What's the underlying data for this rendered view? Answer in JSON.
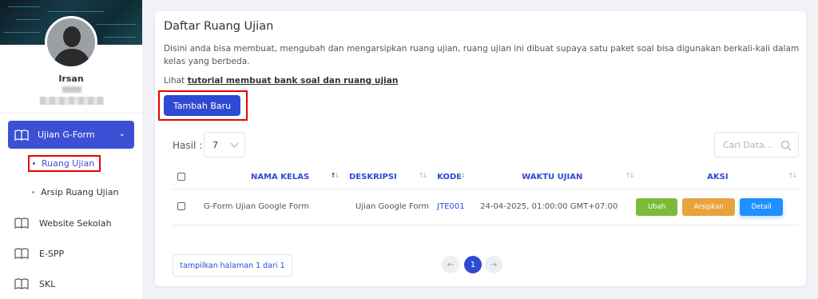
{
  "sidebar": {
    "user_name": "Irsan",
    "menu": {
      "active": {
        "label": "Ujian G-Form",
        "icon": "book-icon"
      },
      "sub_items": [
        {
          "label": "Ruang Ujian"
        },
        {
          "label": "Arsip Ruang Ujian"
        }
      ],
      "items": [
        {
          "label": "Website Sekolah",
          "icon": "book-icon"
        },
        {
          "label": "E-SPP",
          "icon": "book-icon"
        },
        {
          "label": "SKL",
          "icon": "book-icon"
        }
      ]
    }
  },
  "main": {
    "title": "Daftar Ruang Ujian",
    "description": "Disini anda bisa membuat, mengubah dan mengarsipkan ruang ujian, ruang ujian ini dibuat supaya satu paket soal bisa digunakan berkali-kali dalam kelas yang berbeda.",
    "tutorial_prefix": "Lihat",
    "tutorial_link": "tutorial membuat bank soal dan ruang ujian",
    "add_button": "Tambah Baru",
    "hasil_label": "Hasil :",
    "hasil_value": "7",
    "search_placeholder": "Cari Data...",
    "table": {
      "headers": [
        "NAMA KELAS",
        "DESKRIPSI",
        "KODE",
        "WAKTU UJIAN",
        "AKSI"
      ],
      "rows": [
        {
          "nama_kelas": "G-Form Ujian Google Form",
          "deskripsi": "Ujian Google Form",
          "kode": "JTE001",
          "waktu": "24-04-2025, 01:00:00 GMT+07:00",
          "actions": [
            "Ubah",
            "Arsipkan",
            "Detail"
          ]
        }
      ]
    },
    "pagination": {
      "info": "tampilkan halaman 1 dari 1",
      "current": "1"
    }
  },
  "colors": {
    "accent": "#2f4ad2",
    "sidebar_active": "#3c50d6",
    "ubah": "#7cbb3a",
    "arsipkan": "#e8a33d",
    "detail": "#1e90ff",
    "highlight": "#ee0000"
  }
}
